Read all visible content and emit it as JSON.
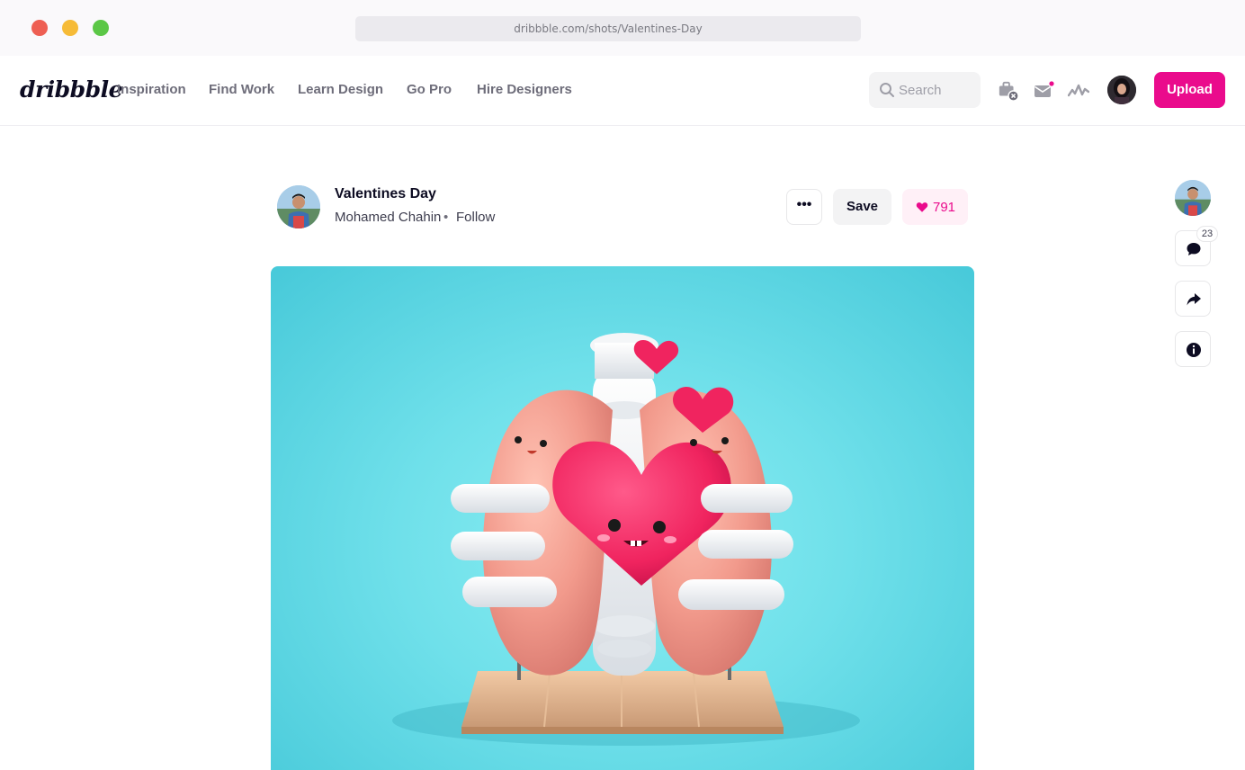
{
  "browser": {
    "url": "dribbble.com/shots/Valentines-Day"
  },
  "nav": {
    "logo": "dribbble",
    "links": [
      "Inspiration",
      "Find Work",
      "Learn Design",
      "Go Pro",
      "Hire Designers"
    ],
    "search_placeholder": "Search",
    "upload_label": "Upload",
    "accent_color": "#ea0b8c"
  },
  "shot": {
    "title": "Valentines Day",
    "author": "Mohamed Chahin",
    "separator": "•",
    "follow_label": "Follow",
    "more_label": "•••",
    "save_label": "Save",
    "likes": "791"
  },
  "rail": {
    "comments_count": "23"
  }
}
